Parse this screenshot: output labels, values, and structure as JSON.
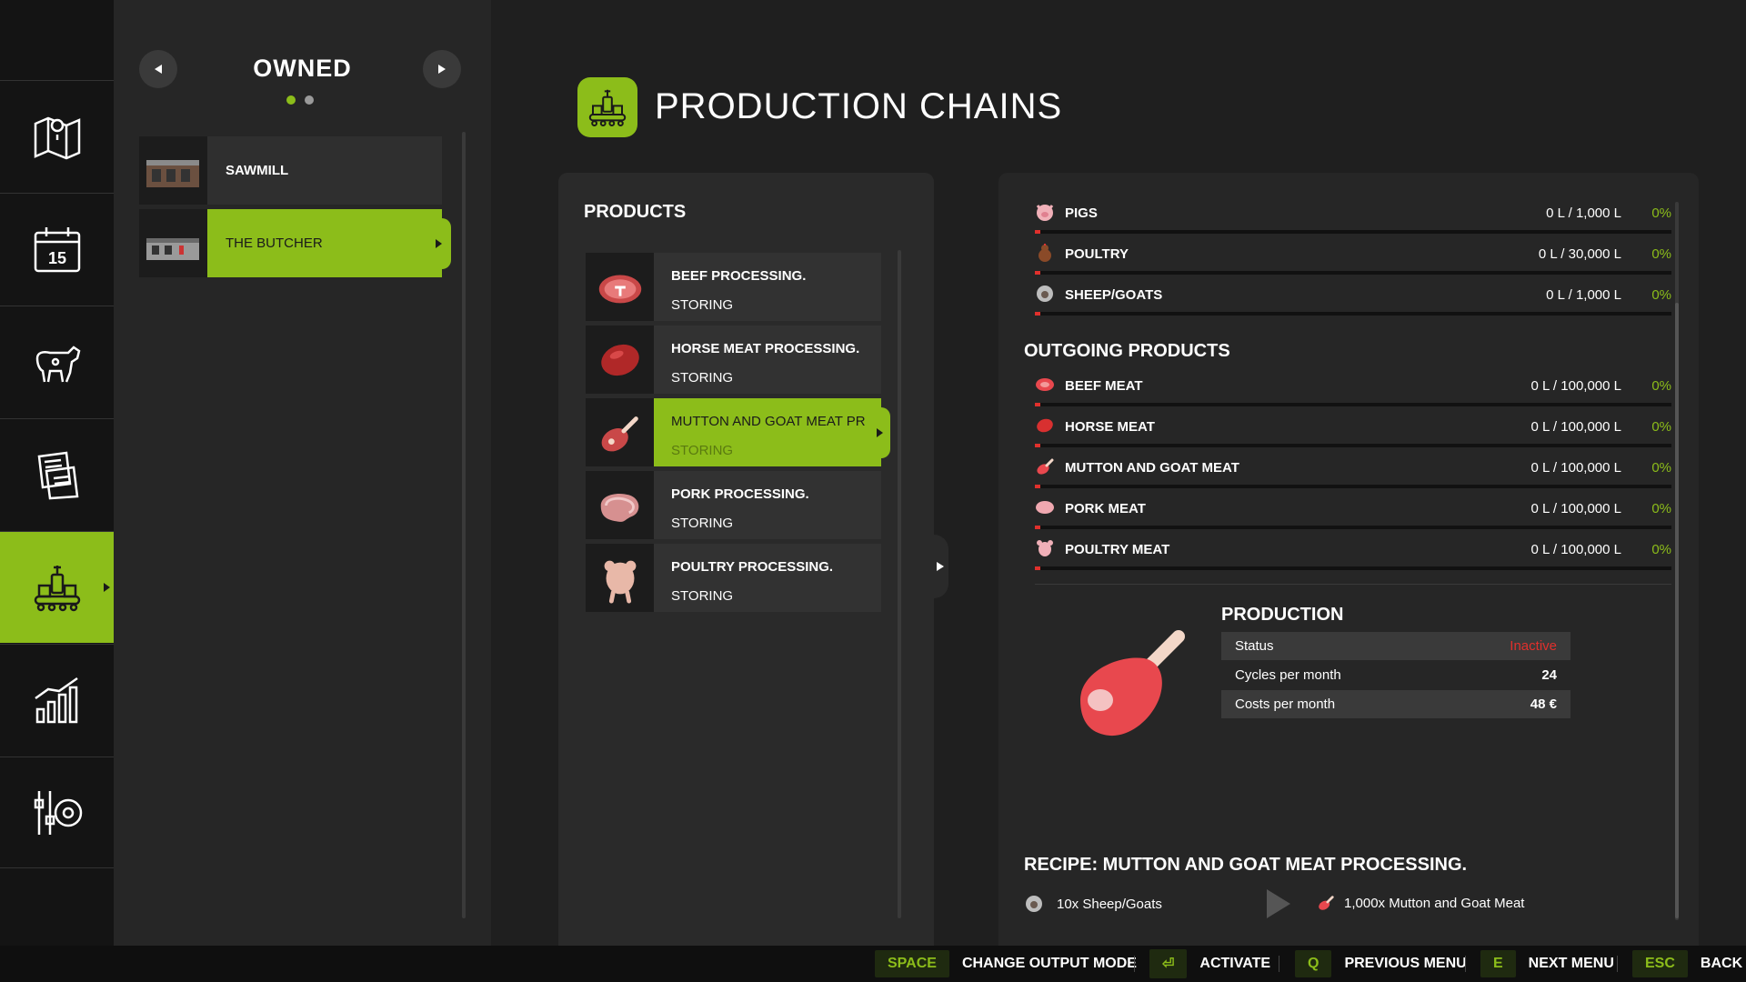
{
  "nav": {
    "items": [
      {
        "name": "map-icon",
        "active": false
      },
      {
        "name": "calendar-icon",
        "active": false,
        "label": "15"
      },
      {
        "name": "animals-icon",
        "active": false
      },
      {
        "name": "contracts-icon",
        "active": false
      },
      {
        "name": "production-icon",
        "active": true
      },
      {
        "name": "statistics-icon",
        "active": false
      },
      {
        "name": "settings-icon",
        "active": false
      }
    ]
  },
  "owned": {
    "title": "OWNED",
    "items": [
      {
        "label": "SAWMILL",
        "active": false
      },
      {
        "label": "THE BUTCHER",
        "active": true
      }
    ],
    "page_dots": 2,
    "active_dot": 0
  },
  "page": {
    "title": "PRODUCTION CHAINS"
  },
  "products": {
    "title": "PRODUCTS",
    "items": [
      {
        "name": "BEEF PROCESSING.",
        "status": "STORING",
        "icon": "beef-icon"
      },
      {
        "name": "HORSE MEAT PROCESSING.",
        "status": "STORING",
        "icon": "horse-meat-icon"
      },
      {
        "name": "MUTTON AND GOAT MEAT PR",
        "status": "STORING",
        "icon": "mutton-icon",
        "active": true
      },
      {
        "name": "PORK PROCESSING.",
        "status": "STORING",
        "icon": "pork-icon"
      },
      {
        "name": "POULTRY PROCESSING.",
        "status": "STORING",
        "icon": "poultry-icon"
      }
    ]
  },
  "incoming": [
    {
      "name": "PIGS",
      "value": "0 L / 1,000 L",
      "percent": "0%",
      "icon": "pig-icon",
      "fill": 0
    },
    {
      "name": "POULTRY",
      "value": "0 L / 30,000 L",
      "percent": "0%",
      "icon": "chicken-icon",
      "fill": 0
    },
    {
      "name": "SHEEP/GOATS",
      "value": "0 L / 1,000 L",
      "percent": "0%",
      "icon": "sheep-icon",
      "fill": 0
    }
  ],
  "outgoing": {
    "title": "OUTGOING PRODUCTS",
    "items": [
      {
        "name": "BEEF MEAT",
        "value": "0 L / 100,000 L",
        "percent": "0%",
        "icon": "beef-meat-icon",
        "fill": 0
      },
      {
        "name": "HORSE MEAT",
        "value": "0 L / 100,000 L",
        "percent": "0%",
        "icon": "horse-meat-icon",
        "fill": 0
      },
      {
        "name": "MUTTON AND GOAT MEAT",
        "value": "0 L / 100,000 L",
        "percent": "0%",
        "icon": "mutton-meat-icon",
        "fill": 0
      },
      {
        "name": "PORK MEAT",
        "value": "0 L / 100,000 L",
        "percent": "0%",
        "icon": "pork-meat-icon",
        "fill": 0
      },
      {
        "name": "POULTRY MEAT",
        "value": "0 L / 100,000 L",
        "percent": "0%",
        "icon": "poultry-meat-icon",
        "fill": 0
      }
    ]
  },
  "production": {
    "title": "PRODUCTION",
    "stats": [
      {
        "label": "Status",
        "value": "Inactive"
      },
      {
        "label": "Cycles per month",
        "value": "24"
      },
      {
        "label": "Costs per month",
        "value": "48 €"
      }
    ]
  },
  "recipe": {
    "title": "RECIPE: MUTTON AND GOAT MEAT PROCESSING.",
    "input": "10x Sheep/Goats",
    "output": "1,000x Mutton and Goat Meat"
  },
  "hints": [
    {
      "key": "SPACE",
      "label": "CHANGE OUTPUT MODE"
    },
    {
      "key": "⏎",
      "label": "ACTIVATE"
    },
    {
      "key": "Q",
      "label": "PREVIOUS MENU"
    },
    {
      "key": "E",
      "label": "NEXT MENU"
    },
    {
      "key": "ESC",
      "label": "BACK"
    }
  ],
  "colors": {
    "accent": "#8cbd1a",
    "inactive": "#e0302c",
    "meat": "#e8484e"
  }
}
